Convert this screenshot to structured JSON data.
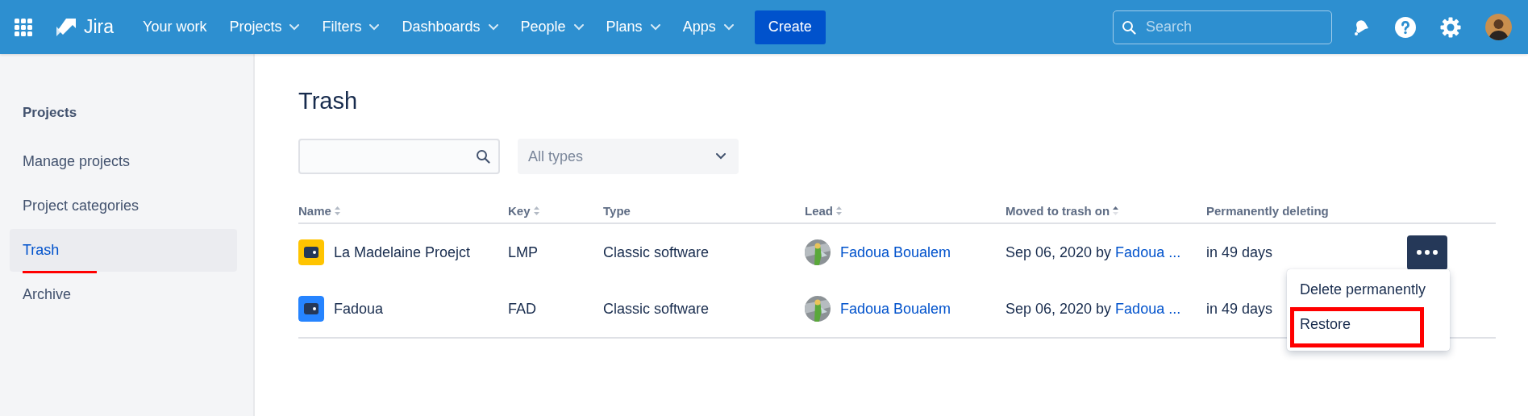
{
  "topbar": {
    "product": "Jira",
    "nav": [
      {
        "label": "Your work",
        "dropdown": false
      },
      {
        "label": "Projects",
        "dropdown": true
      },
      {
        "label": "Filters",
        "dropdown": true
      },
      {
        "label": "Dashboards",
        "dropdown": true
      },
      {
        "label": "People",
        "dropdown": true
      },
      {
        "label": "Plans",
        "dropdown": true
      },
      {
        "label": "Apps",
        "dropdown": true
      }
    ],
    "create": "Create",
    "search": {
      "placeholder": "Search"
    }
  },
  "sidebar": {
    "heading": "Projects",
    "items": [
      {
        "label": "Manage projects",
        "selected": false,
        "marked": false
      },
      {
        "label": "Project categories",
        "selected": false,
        "marked": false
      },
      {
        "label": "Trash",
        "selected": true,
        "marked": true
      },
      {
        "label": "Archive",
        "selected": false,
        "marked": false
      }
    ]
  },
  "page": {
    "title": "Trash",
    "filter": {
      "placeholder": "All types"
    },
    "table": {
      "columns": [
        {
          "label": "Name",
          "sortable": true,
          "sorted": false
        },
        {
          "label": "Key",
          "sortable": true,
          "sorted": false
        },
        {
          "label": "Type",
          "sortable": false
        },
        {
          "label": "Lead",
          "sortable": true,
          "sorted": false
        },
        {
          "label": "Moved to trash on",
          "sortable": true,
          "sorted": true
        },
        {
          "label": "Permanently deleting",
          "sortable": false
        }
      ],
      "rows": [
        {
          "name": "La Madelaine Proejct",
          "color": "#ffc400",
          "key": "LMP",
          "type": "Classic software",
          "lead": "Fadoua Boualem",
          "moved": "Sep 06, 2020 by",
          "moved_by": "Fadoua ...",
          "deleting": "in 49 days",
          "menu_open": true,
          "menu": [
            {
              "label": "Delete permanently",
              "marked": false
            },
            {
              "label": "Restore",
              "marked": true
            }
          ]
        },
        {
          "name": "Fadoua",
          "color": "#2684ff",
          "key": "FAD",
          "type": "Classic software",
          "lead": "Fadoua Boualem",
          "moved": "Sep 06, 2020 by",
          "moved_by": "Fadoua ...",
          "deleting": "in 49 days",
          "menu_open": false,
          "menu": []
        }
      ]
    }
  }
}
